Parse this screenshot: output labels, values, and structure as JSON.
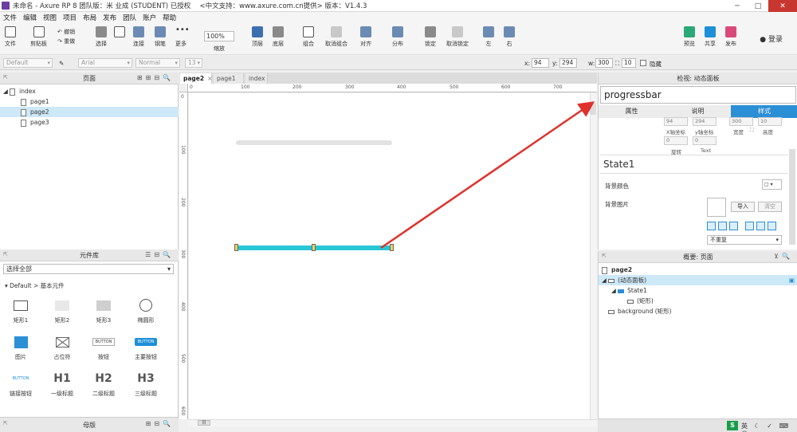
{
  "window": {
    "title": "未命名 - Axure RP 8 团队版：米 业成 (STUDENT) 已授权　 <中文支持：www.axure.com.cn提供> 版本：V1.4.3",
    "minimize": "─",
    "maximize": "□",
    "close": "✕"
  },
  "menu": [
    "文件",
    "编辑",
    "视图",
    "项目",
    "布局",
    "发布",
    "团队",
    "账户",
    "帮助"
  ],
  "toolbar": {
    "file": "文件",
    "clipboard": "剪贴板",
    "undo": "撤销",
    "redo": "重做",
    "select": "选择",
    "connect": "连接",
    "pen": "钢笔",
    "more": "更多",
    "zoom_value": "100%",
    "zoom_label": "缩放",
    "top": "顶层",
    "bottom": "底层",
    "group": "组合",
    "ungroup": "取消组合",
    "align": "对齐",
    "distribute": "分布",
    "lock": "锁定",
    "unlock": "取消锁定",
    "left": "左",
    "right": "右",
    "preview": "预览",
    "share": "共享",
    "publish": "发布",
    "login": "登录"
  },
  "stylebar": {
    "style": "Default",
    "font": "Arial",
    "weight": "Normal",
    "size": "13",
    "x_label": "x:",
    "x_value": "94",
    "y_label": "y:",
    "y_value": "294",
    "w_label": "w:",
    "w_value": "300",
    "h_value": "10",
    "hidden": "隐藏"
  },
  "pages_panel": {
    "title": "页面",
    "items": [
      {
        "label": "index"
      },
      {
        "label": "page1"
      },
      {
        "label": "page2"
      },
      {
        "label": "page3"
      }
    ]
  },
  "library": {
    "title": "元件库",
    "select": "选择全部",
    "category": "Default > 基本元件",
    "widgets": [
      "矩形1",
      "矩形2",
      "矩形3",
      "椭圆形",
      "图片",
      "占位符",
      "按钮",
      "主要按钮",
      "链接按钮",
      "一级标题",
      "二级标题",
      "三级标题"
    ],
    "button_text": "BUTTON",
    "h1": "H1",
    "h2": "H2",
    "h3": "H3"
  },
  "masters": {
    "title": "母版"
  },
  "tabs": [
    {
      "label": "page2",
      "close": "×"
    },
    {
      "label": "page1"
    },
    {
      "label": "index"
    }
  ],
  "ruler": {
    "h": [
      "0",
      "100",
      "200",
      "300",
      "400",
      "500",
      "600",
      "700"
    ],
    "v": [
      "0",
      "100",
      "200",
      "300",
      "400",
      "500",
      "600"
    ]
  },
  "inspector": {
    "header": "检视: 动态面板",
    "name": "progressbar",
    "tabs": [
      "属性",
      "说明",
      "样式"
    ],
    "x": "94",
    "y": "294",
    "w": "300",
    "h": "10",
    "x_label": "X轴坐标",
    "y_label": "y轴坐标",
    "w_label": "宽度",
    "h_label": "高度",
    "rot_value": "0",
    "text_value": "0",
    "rot_label": "旋转",
    "text_label": "Text",
    "state": "State1",
    "bg_color": "背景颜色",
    "bg_image": "背景图片",
    "import": "导入",
    "clear": "清空",
    "repeat": "不重复"
  },
  "outline": {
    "title": "概要: 页面",
    "page": "page2",
    "items": [
      {
        "label": "(动态面板)"
      },
      {
        "label": "State1"
      },
      {
        "label": "(矩形)"
      },
      {
        "label": "background (矩形)"
      }
    ]
  },
  "tray": {
    "ime": "S",
    "ime_text": "英 ☾ ✓ ⌨ ☺"
  },
  "colors": {
    "progress_fill": "#28c7d6",
    "progress_track": "#e2e2e2",
    "accent": "#2b8fd6",
    "arrow": "#e0322c"
  }
}
